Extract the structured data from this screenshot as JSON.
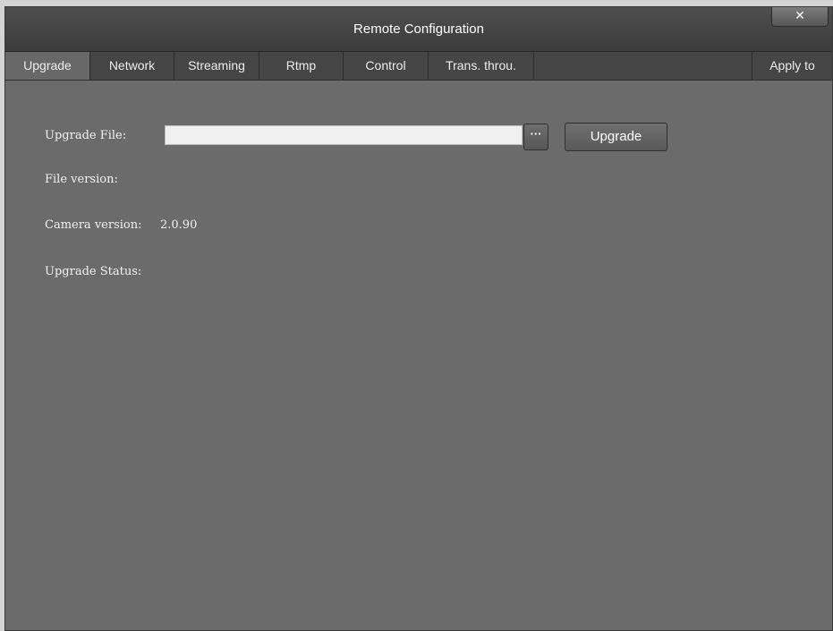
{
  "window": {
    "title": "Remote Configuration",
    "close_label": "✕"
  },
  "tabs": [
    {
      "label": "Upgrade",
      "active": true
    },
    {
      "label": "Network",
      "active": false
    },
    {
      "label": "Streaming",
      "active": false
    },
    {
      "label": "Rtmp",
      "active": false
    },
    {
      "label": "Control",
      "active": false
    },
    {
      "label": "Trans. throu.",
      "active": false
    }
  ],
  "apply_to_label": "Apply to",
  "upgrade": {
    "file_label": "Upgrade File:",
    "file_value": "",
    "browse_label": "···",
    "upgrade_button_label": "Upgrade",
    "file_version_label": "File version:",
    "file_version_value": "",
    "camera_version_label": "Camera version:",
    "camera_version_value": "2.0.90",
    "status_label": "Upgrade Status:",
    "status_value": ""
  },
  "colors": {
    "window_bg": "#6b6b6b",
    "titlebar_bg": "#454545",
    "text": "#f2f2f2"
  }
}
